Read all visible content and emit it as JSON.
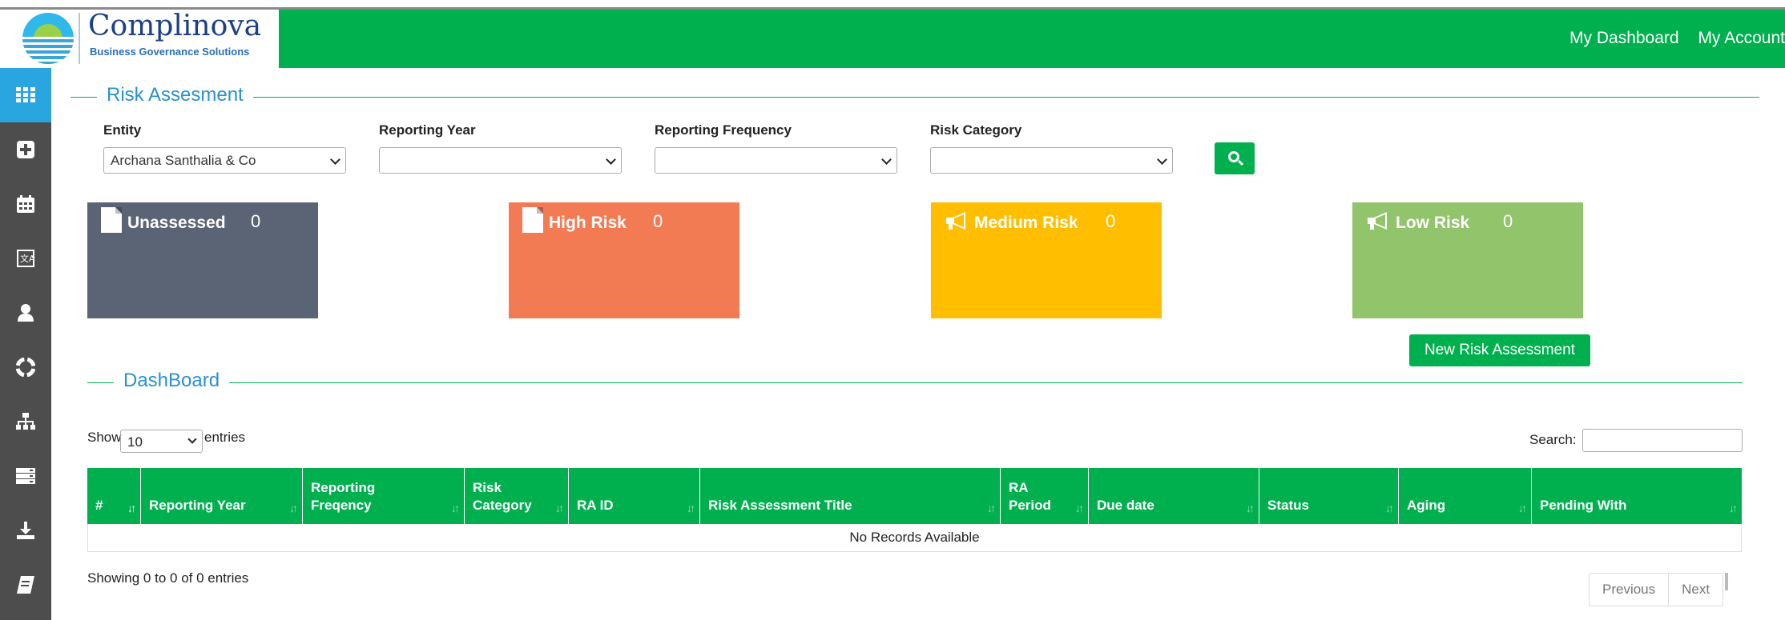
{
  "brand": {
    "name": "Complinova",
    "tagline": "Business Governance Solutions"
  },
  "header": {
    "links": [
      "My Dashboard",
      "My Account"
    ]
  },
  "sidebar": {
    "items": [
      {
        "icon": "grid-icon",
        "active": true
      },
      {
        "icon": "plus-square-icon",
        "active": false
      },
      {
        "icon": "calendar-icon",
        "active": false
      },
      {
        "icon": "translate-icon",
        "active": false
      },
      {
        "icon": "user-icon",
        "active": false
      },
      {
        "icon": "lifebuoy-icon",
        "active": false
      },
      {
        "icon": "sitemap-icon",
        "active": false
      },
      {
        "icon": "server-icon",
        "active": false
      },
      {
        "icon": "download-icon",
        "active": false
      },
      {
        "icon": "book-icon",
        "active": false
      }
    ]
  },
  "filters": {
    "title": "Risk Assesment",
    "entity": {
      "label": "Entity",
      "value": "Archana Santhalia & Co"
    },
    "reporting_year": {
      "label": "Reporting Year",
      "value": ""
    },
    "reporting_frequency": {
      "label": "Reporting Frequency",
      "value": ""
    },
    "risk_category": {
      "label": "Risk Category",
      "value": ""
    },
    "search_icon": "search-icon"
  },
  "cards": [
    {
      "label": "Unassessed",
      "value": "0",
      "color": "#5b6475",
      "icon": "file-icon"
    },
    {
      "label": "High Risk",
      "value": "0",
      "color": "#f27b54",
      "icon": "file-icon"
    },
    {
      "label": "Medium Risk",
      "value": "0",
      "color": "#ffbf00",
      "icon": "bullhorn-icon"
    },
    {
      "label": "Low Risk",
      "value": "0",
      "color": "#92c46c",
      "icon": "bullhorn-icon"
    }
  ],
  "actions": {
    "new_risk_assessment": "New Risk Assessment"
  },
  "dashboard": {
    "title": "DashBoard",
    "show_label": "Show",
    "entries_value": "10",
    "entries_label": "entries",
    "search_label": "Search:",
    "columns": [
      "#",
      "Reporting Year",
      "Reporting Freqency",
      "Risk Category",
      "RA ID",
      "Risk Assessment Title",
      "RA Period",
      "Due date",
      "Status",
      "Aging",
      "Pending With"
    ],
    "empty_message": "No Records Available",
    "info": "Showing 0 to 0 of 0 entries",
    "pager": {
      "previous": "Previous",
      "next": "Next"
    }
  },
  "colors": {
    "primary": "#00b04f",
    "accent": "#29a6e0",
    "sidebar": "#4d4d4d"
  }
}
